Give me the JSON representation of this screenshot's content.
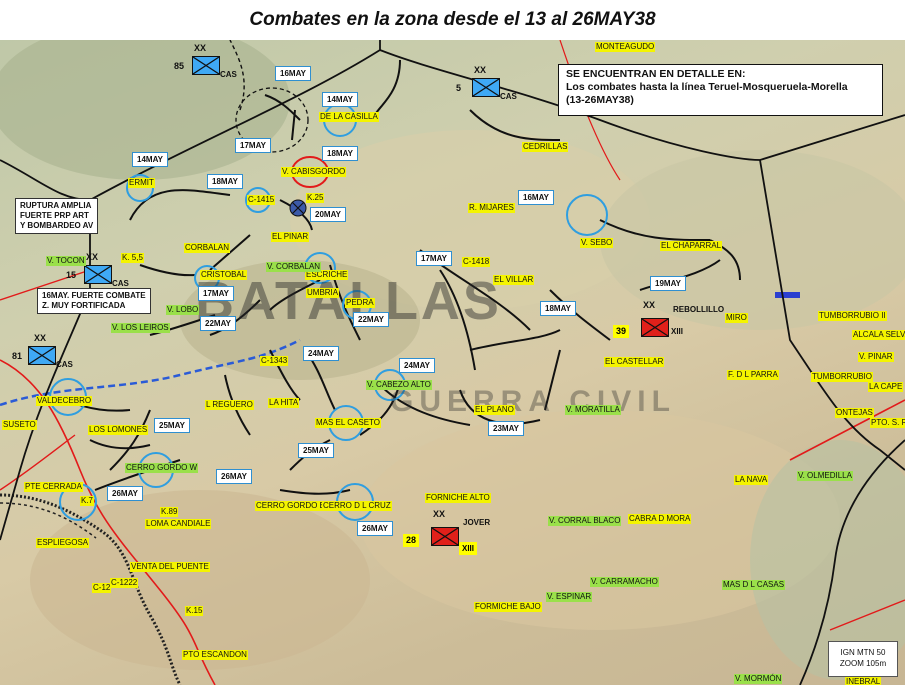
{
  "title": "Combates en la zona desde el 13 al 26MAY38",
  "legend": {
    "heading": "SE ENCUENTRAN EN DETALLE EN:",
    "line1": "Los combates hasta la línea Teruel-Mosqueruela-Morella",
    "line2": "(13-26MAY38)"
  },
  "notes": {
    "ruptura": [
      "RUPTURA AMPLIA",
      "FUERTE PRP ART",
      "Y BOMBARDEO AV"
    ],
    "combate": [
      "16MAY. FUERTE COMBATE",
      "Z. MUY FORTIFICADA"
    ]
  },
  "scale": {
    "line1": "IGN MTN 50",
    "line2": "ZOOM  105m"
  },
  "watermark": {
    "line1": "BATALLAS",
    "line2": "GUERRA CIVIL"
  },
  "units": [
    {
      "id": "85",
      "number": "85",
      "tag": "CAS",
      "echelon": "XX",
      "color": "#3fa9f5"
    },
    {
      "id": "5",
      "number": "5",
      "tag": "CAS",
      "echelon": "XX",
      "color": "#3fa9f5"
    },
    {
      "id": "15",
      "number": "15",
      "tag": "CAS",
      "echelon": "XX",
      "color": "#3fa9f5"
    },
    {
      "id": "81",
      "number": "81",
      "tag": "CAS",
      "echelon": "XX",
      "color": "#3fa9f5"
    },
    {
      "id": "39",
      "number": "39",
      "tag": "REBOLLILLO",
      "corps": "XIII",
      "echelon": "XX",
      "color": "#e0201a"
    },
    {
      "id": "28",
      "number": "28",
      "tag": "JOVER",
      "corps": "XIII",
      "echelon": "XX",
      "color": "#e0201a"
    }
  ],
  "dates": [
    "16MAY",
    "14MAY",
    "17MAY",
    "18MAY",
    "14MAY",
    "18MAY",
    "20MAY",
    "16MAY",
    "17MAY",
    "19MAY",
    "18MAY",
    "17MAY",
    "22MAY",
    "22MAY",
    "24MAY",
    "24MAY",
    "25MAY",
    "23MAY",
    "25MAY",
    "26MAY",
    "26MAY",
    "26MAY"
  ],
  "places_yellow": [
    "MONTEAGUDO",
    "DE LA CASILLA",
    "CEDRILLAS",
    "ERMIT",
    "C-1415",
    "V. CABISGORDO",
    "K.25",
    "EL PINAR",
    "CORBALAN",
    "R. MIJARES",
    "V. SEBO",
    "EL CHAPARRAL",
    "EL VILLAR",
    "C-1418",
    "K. 5,5",
    "CRISTOBAL",
    "ESCRICHE",
    "UMBRIA",
    "PEDRA",
    "EL CASTELLAR",
    "TUMBORRUBIO II",
    "ALCALA SELVA",
    "V. PINAR",
    "TUMBORRUBIO",
    "F. D L PARRA",
    "LA CAPE",
    "ONTEJAS",
    "PTO. S. RE",
    "C-1343",
    "L REGUERO",
    "LA HITA",
    "EL PLANO",
    "MAS EL CASETO",
    "VALDECEBRO",
    "SUSETO",
    "LOS LOMONES",
    "PTE CERRADA",
    "K.7",
    "K.89",
    "LOMA CANDIALE",
    "CERRO GORDO E",
    "CERRO D L CRUZ",
    "FORNICHE ALTO",
    "CABRA D MORA",
    "LA NAVA",
    "ESPLIEGOSA",
    "VENTA DEL PUENTE",
    "C-12",
    "C-1222",
    "K.15",
    "FORMICHE BAJO",
    "PTO ESCANDON",
    "INEBRAL",
    "MIRO"
  ],
  "places_green": [
    "V. TOCON",
    "V. CORBALAN",
    "V. LOBO",
    "V. LOS LEIROS",
    "V. CABEZO ALTO",
    "V. MORATILLA",
    "CERRO GORDO W",
    "V. OLMEDILLA",
    "V. CORRAL BLACO",
    "V. CARRAMACHO",
    "MAS D L CASAS",
    "V. ESPINAR",
    "V. MORMÓN"
  ]
}
